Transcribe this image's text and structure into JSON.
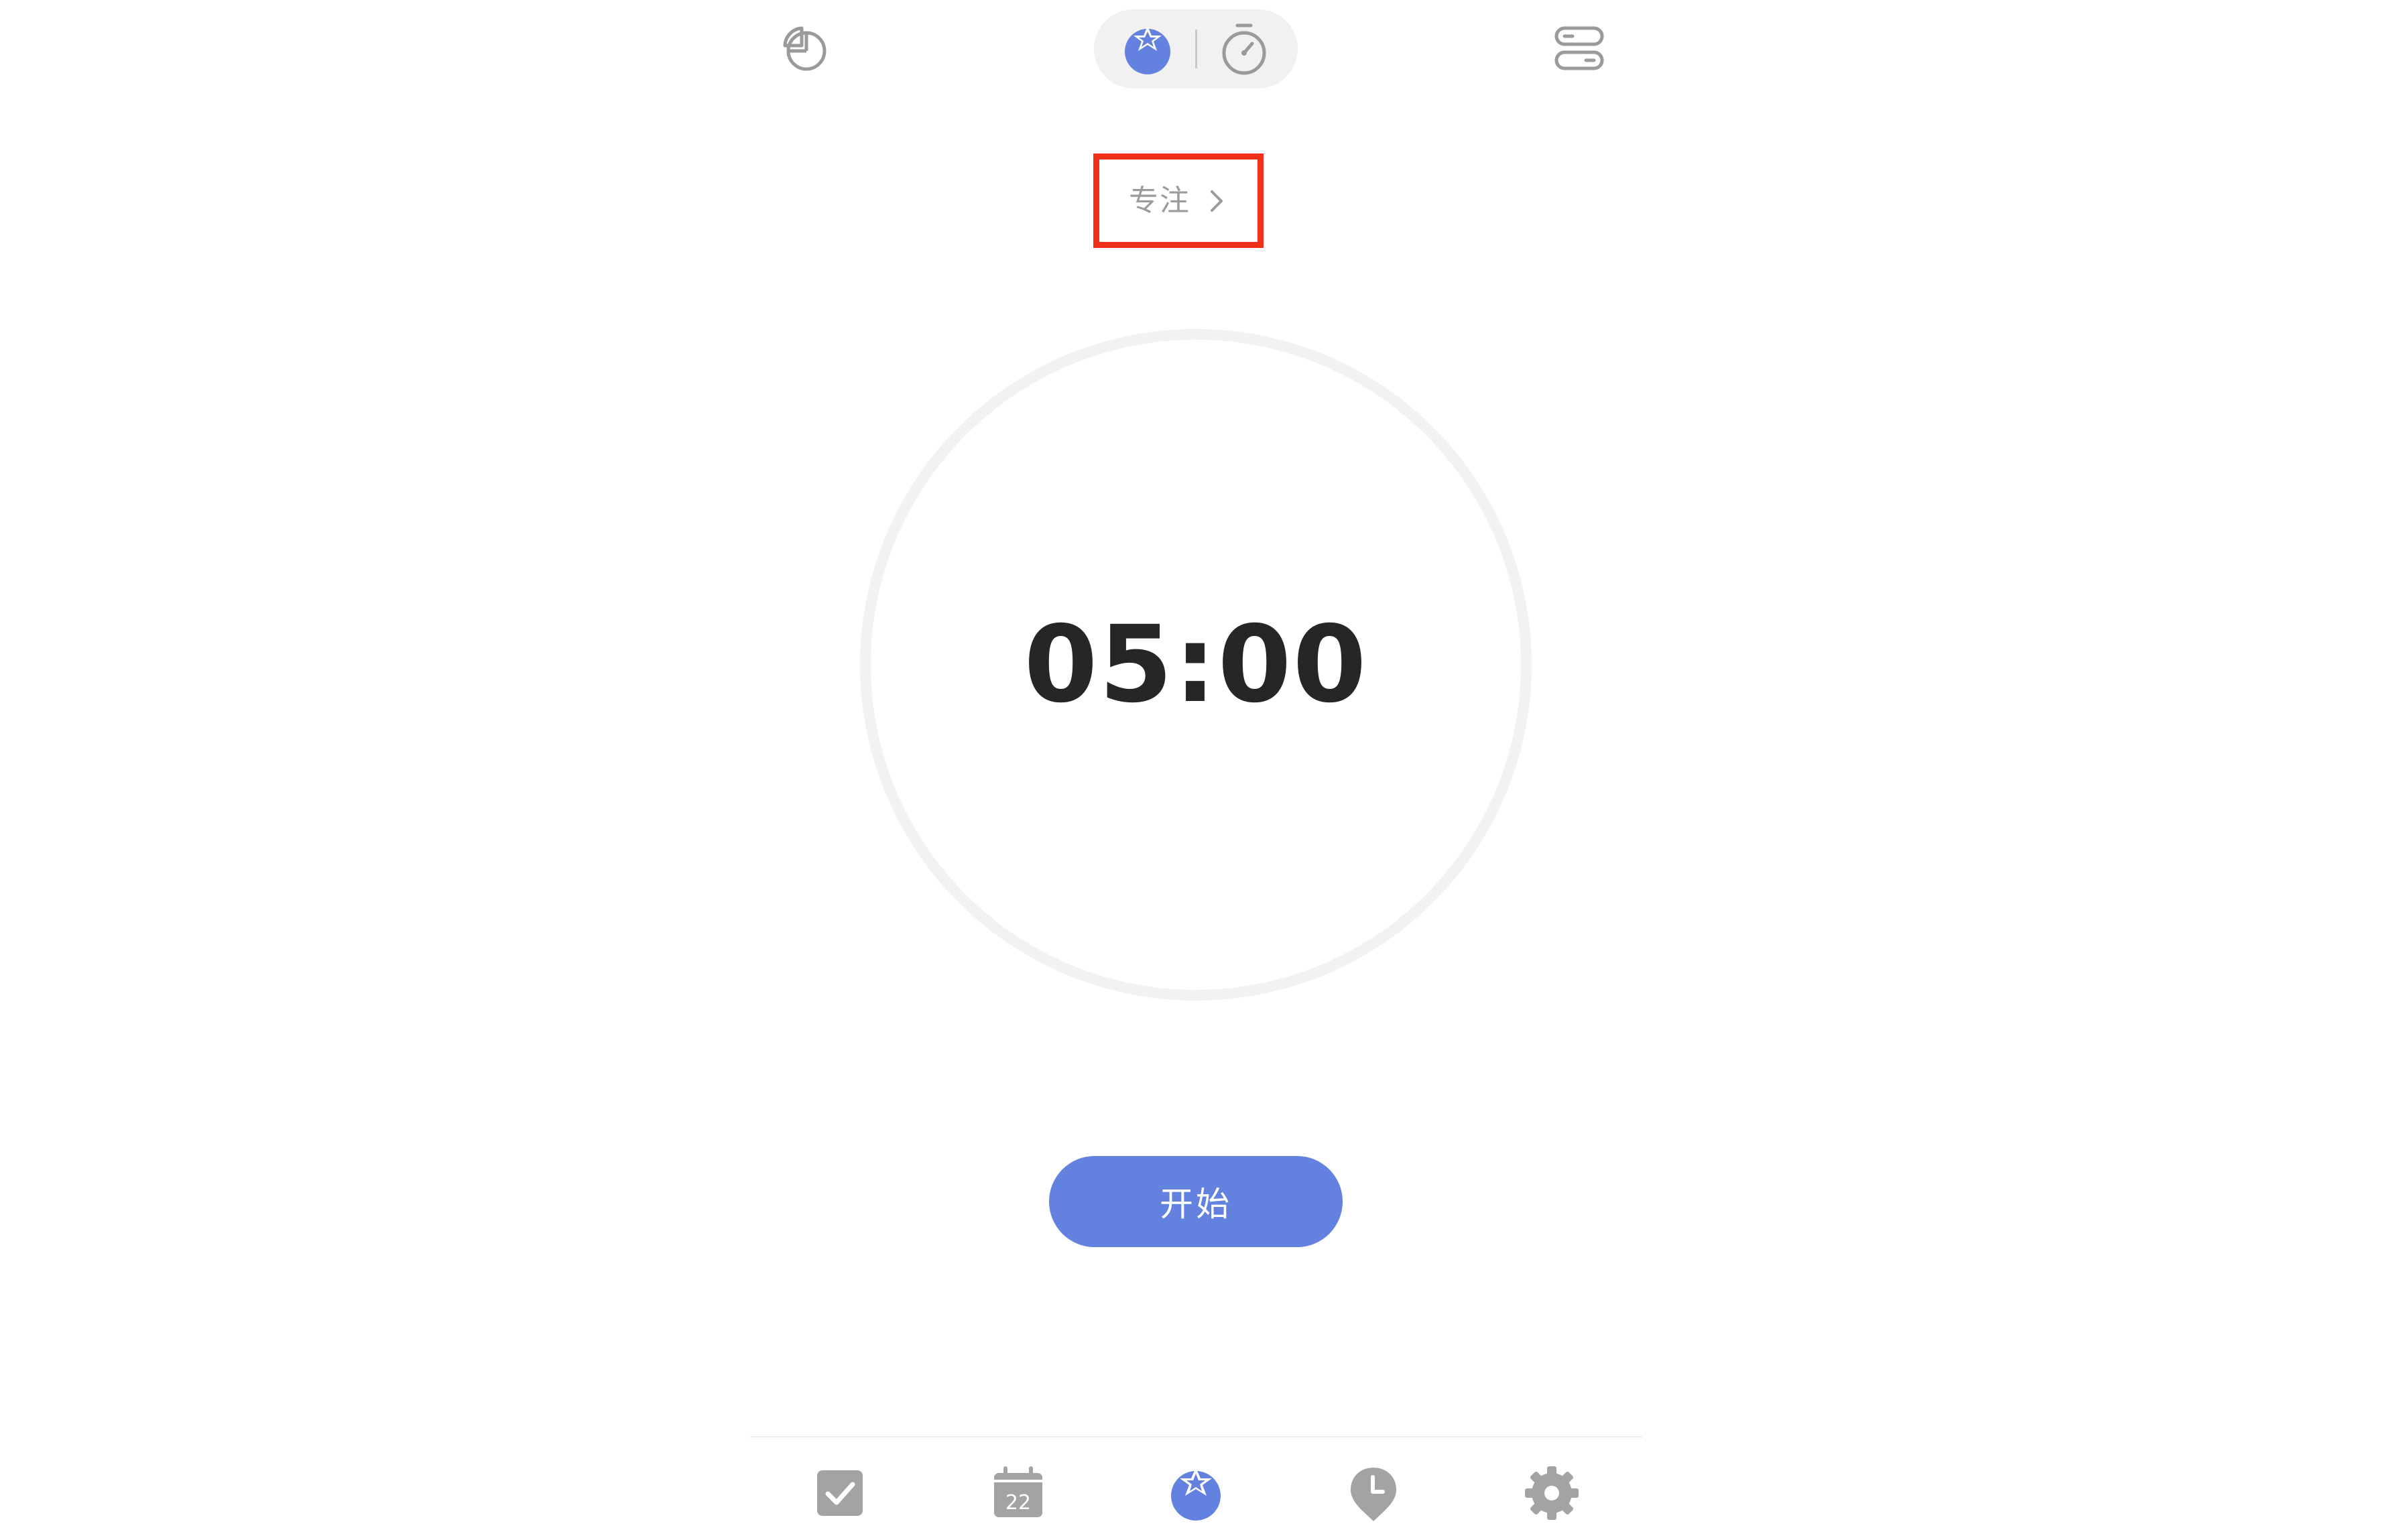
{
  "header": {
    "icons": {
      "stats": "pie-chart-icon",
      "pomodoro_mode": "pomodoro-icon",
      "stopwatch_mode": "stopwatch-icon",
      "layout": "layout-toggle-icon"
    },
    "active_mode": "pomodoro"
  },
  "focus": {
    "label": "专注",
    "chevron": "chevron-right-icon"
  },
  "timer": {
    "display": "05:00",
    "progress": 0
  },
  "start_button": {
    "label": "开始"
  },
  "bottom_nav": {
    "items": [
      {
        "icon": "tasks-check-icon",
        "active": false
      },
      {
        "icon": "calendar-icon",
        "active": false,
        "day": "22"
      },
      {
        "icon": "pomodoro-icon",
        "active": true
      },
      {
        "icon": "habit-clock-icon",
        "active": false
      },
      {
        "icon": "settings-gear-icon",
        "active": false
      }
    ]
  },
  "colors": {
    "accent": "#6381df",
    "inactive_icon": "#a3a3a3",
    "ring": "#f2f2f2",
    "highlight_box": "#f0301a",
    "timer_text": "#262626"
  }
}
